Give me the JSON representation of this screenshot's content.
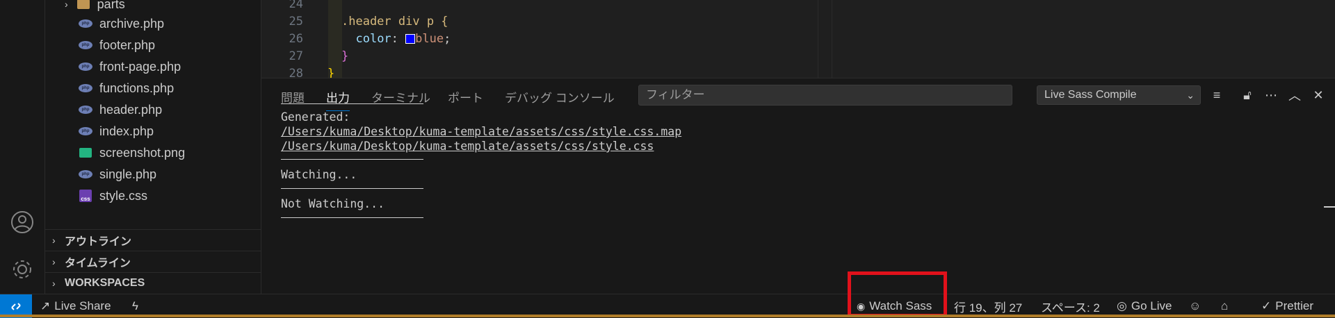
{
  "sidebar": {
    "folder": "parts",
    "files": [
      {
        "name": "archive.php",
        "type": "php"
      },
      {
        "name": "footer.php",
        "type": "php"
      },
      {
        "name": "front-page.php",
        "type": "php"
      },
      {
        "name": "functions.php",
        "type": "php"
      },
      {
        "name": "header.php",
        "type": "php"
      },
      {
        "name": "index.php",
        "type": "php"
      },
      {
        "name": "screenshot.png",
        "type": "image"
      },
      {
        "name": "single.php",
        "type": "php"
      },
      {
        "name": "style.css",
        "type": "css"
      }
    ],
    "sections": [
      "アウトライン",
      "タイムライン",
      "WORKSPACES"
    ]
  },
  "editor": {
    "lines": [
      {
        "num": "24",
        "code": ""
      },
      {
        "num": "25",
        "code": ".header div p {"
      },
      {
        "num": "26",
        "code": "  color: blue;"
      },
      {
        "num": "27",
        "code": "}"
      },
      {
        "num": "28",
        "code": "}"
      }
    ]
  },
  "panel": {
    "tabs": [
      "問題",
      "出力",
      "ターミナル",
      "ポート",
      "デバッグ コンソール"
    ],
    "active_tab": "出力",
    "filter_placeholder": "フィルター",
    "channel": "Live Sass Compile",
    "output": {
      "generated_label": "Generated:",
      "paths": [
        "/Users/kuma/Desktop/kuma-template/assets/css/style.css.map",
        "/Users/kuma/Desktop/kuma-template/assets/css/style.css"
      ],
      "watching": "Watching...",
      "not_watching": "Not Watching..."
    }
  },
  "statusbar": {
    "live_share": "Live Share",
    "watch_sass": "Watch Sass",
    "position": "行 19、列 27",
    "spaces": "スペース: 2",
    "go_live": "Go Live",
    "prettier": "Prettier"
  },
  "colors": {
    "accent": "#0078d4",
    "highlight_box": "#e1111b",
    "keyword_blue": "#0000ff"
  }
}
